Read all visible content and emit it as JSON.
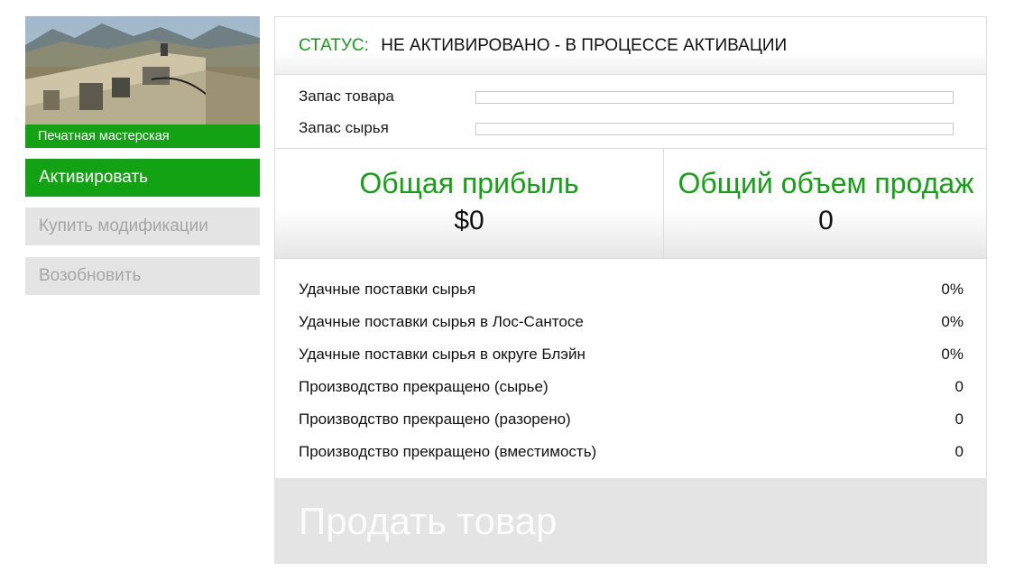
{
  "business": {
    "name": "Печатная мастерская",
    "image_icon": "building-photo"
  },
  "menu": {
    "activate": "Активировать",
    "buy_upgrades": "Купить модификации",
    "resume": "Возобновить"
  },
  "status": {
    "label": "СТАТУС:",
    "value": "НЕ АКТИВИРОВАНО - В ПРОЦЕССЕ АКТИВАЦИИ"
  },
  "stock": {
    "product_label": "Запас товара",
    "product_level": 0,
    "supplies_label": "Запас сырья",
    "supplies_level": 0
  },
  "totals": {
    "earnings_label": "Общая прибыль",
    "earnings_value": "$0",
    "sales_label": "Общий объем продаж",
    "sales_value": "0"
  },
  "stats": [
    {
      "label": "Удачные поставки сырья",
      "value": "0%"
    },
    {
      "label": "Удачные поставки сырья в Лос-Сантосе",
      "value": "0%"
    },
    {
      "label": "Удачные поставки сырья в округе Блэйн",
      "value": "0%"
    },
    {
      "label": "Производство прекращено (сырье)",
      "value": "0"
    },
    {
      "label": "Производство прекращено (разорено)",
      "value": "0"
    },
    {
      "label": "Производство прекращено (вместимость)",
      "value": "0"
    }
  ],
  "sell": {
    "label": "Продать товар"
  },
  "colors": {
    "accent": "#14a215",
    "disabled_bg": "#e4e4e4",
    "disabled_text": "#a6a6a6"
  }
}
